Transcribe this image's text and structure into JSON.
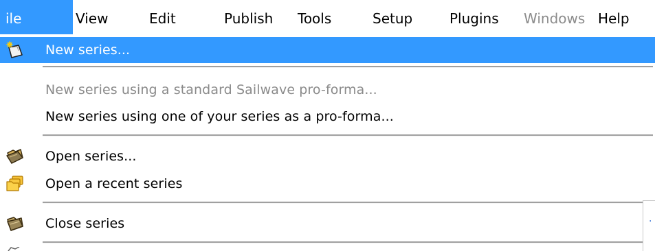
{
  "menubar": {
    "items": [
      {
        "label": "ile",
        "state": "active"
      },
      {
        "label": "View",
        "state": "normal"
      },
      {
        "label": "Edit",
        "state": "normal"
      },
      {
        "label": "Publish",
        "state": "normal"
      },
      {
        "label": "Tools",
        "state": "normal"
      },
      {
        "label": "Setup",
        "state": "normal"
      },
      {
        "label": "Plugins",
        "state": "normal"
      },
      {
        "label": "Windows",
        "state": "disabled"
      },
      {
        "label": "Help",
        "state": "normal"
      }
    ]
  },
  "file_menu": {
    "items": [
      {
        "label": "New series...",
        "icon": "new-series-icon",
        "state": "highlighted"
      },
      {
        "label": "New series using a standard Sailwave pro-forma...",
        "state": "disabled"
      },
      {
        "label": "New series using one of your series as a pro-forma...",
        "state": "normal"
      },
      {
        "label": "Open series...",
        "icon": "open-folder-icon",
        "state": "normal"
      },
      {
        "label": "Open a recent series",
        "icon": "recent-folders-icon",
        "state": "normal"
      },
      {
        "label": "Close series",
        "icon": "close-folder-icon",
        "state": "normal"
      }
    ]
  },
  "colors": {
    "highlight": "#3399ff",
    "disabled_text": "#8a8a8a",
    "separator": "#a0a0a0"
  }
}
